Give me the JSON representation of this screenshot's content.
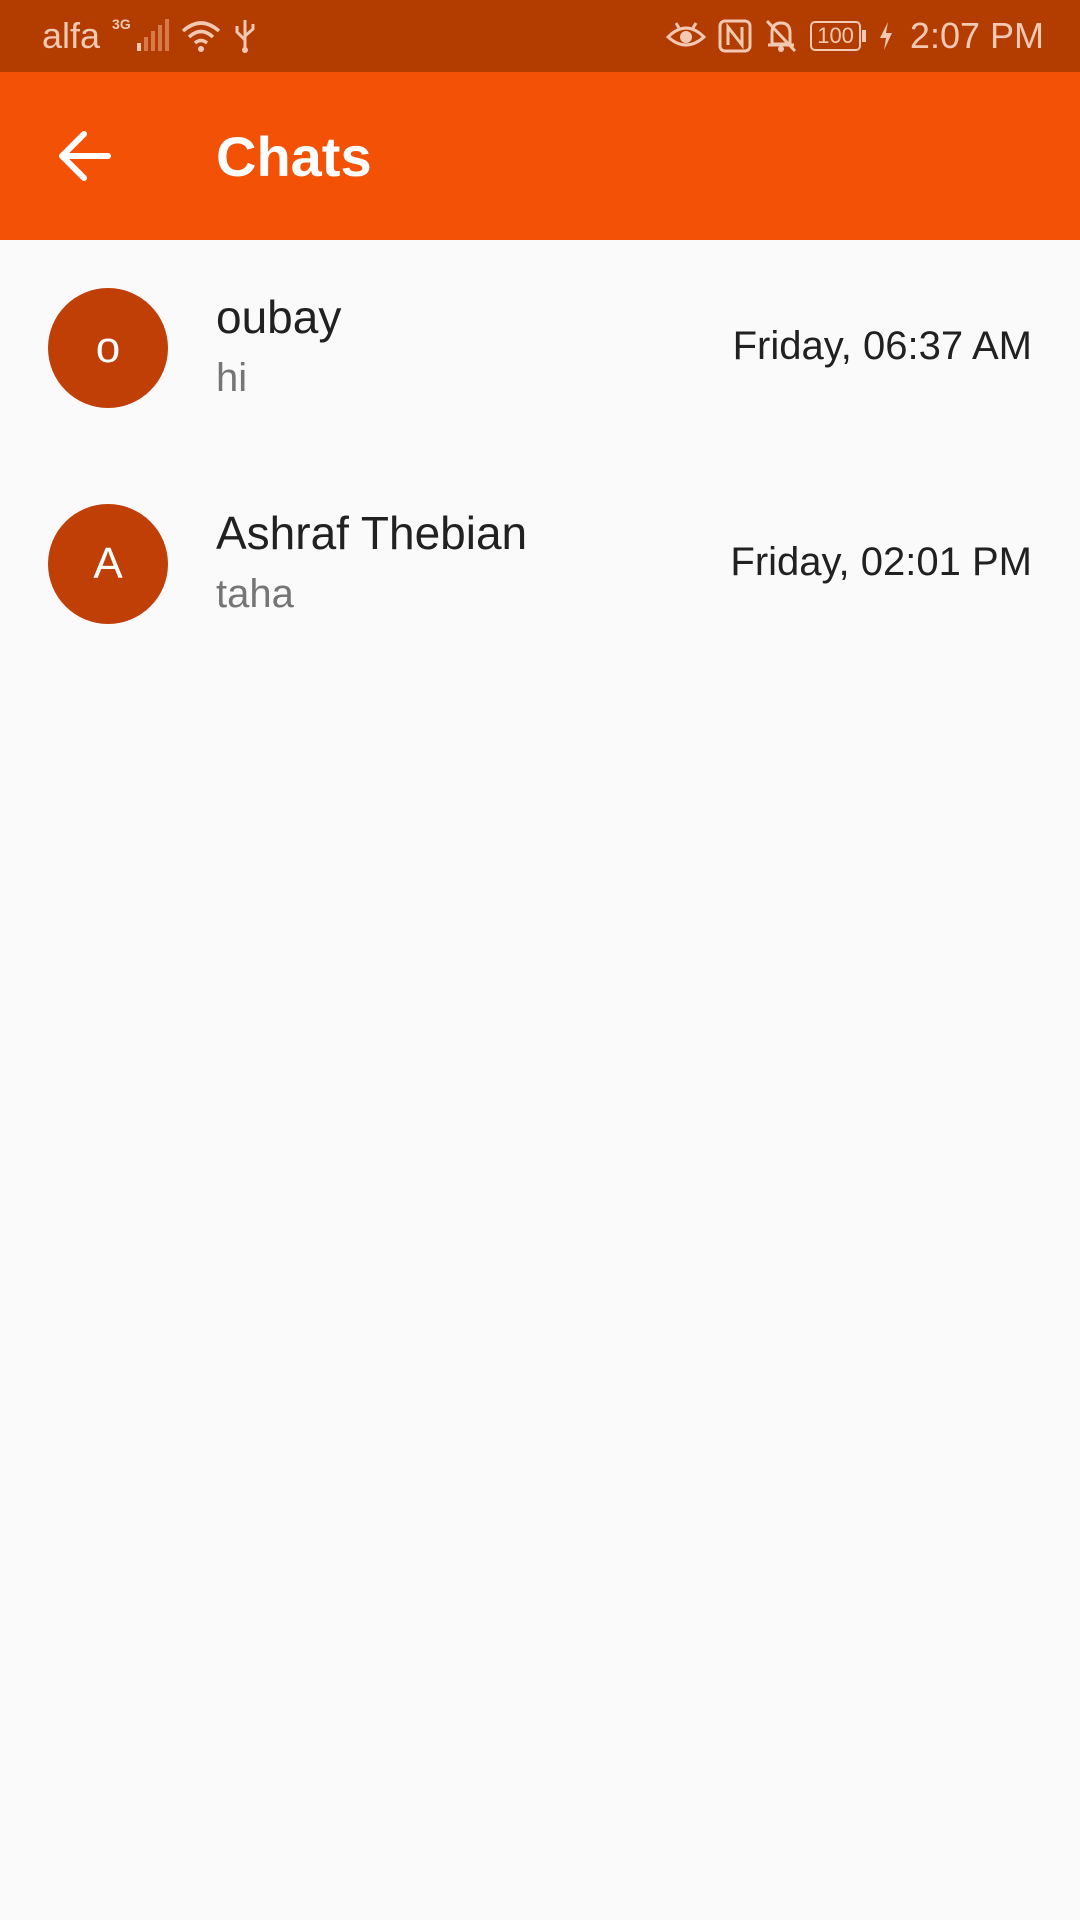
{
  "status_bar": {
    "carrier": "alfa",
    "network_type": "3G",
    "battery": "100",
    "time": "2:07 PM",
    "icons": [
      "signal-icon",
      "wifi-icon",
      "usb-icon",
      "eye-comfort-icon",
      "nfc-icon",
      "notifications-off-icon",
      "battery-icon",
      "charging-icon"
    ]
  },
  "app_bar": {
    "title": "Chats",
    "back_icon": "arrow-left-icon",
    "color": "#f35206"
  },
  "chats": [
    {
      "initial": "o",
      "name": "oubay",
      "preview": "hi",
      "time": "Friday, 06:37 AM"
    },
    {
      "initial": "A",
      "name": "Ashraf Thebian",
      "preview": "taha",
      "time": "Friday, 02:01 PM"
    }
  ],
  "colors": {
    "status_bar": "#b33c00",
    "avatar": "#bf3f06",
    "background": "#fafafa"
  }
}
